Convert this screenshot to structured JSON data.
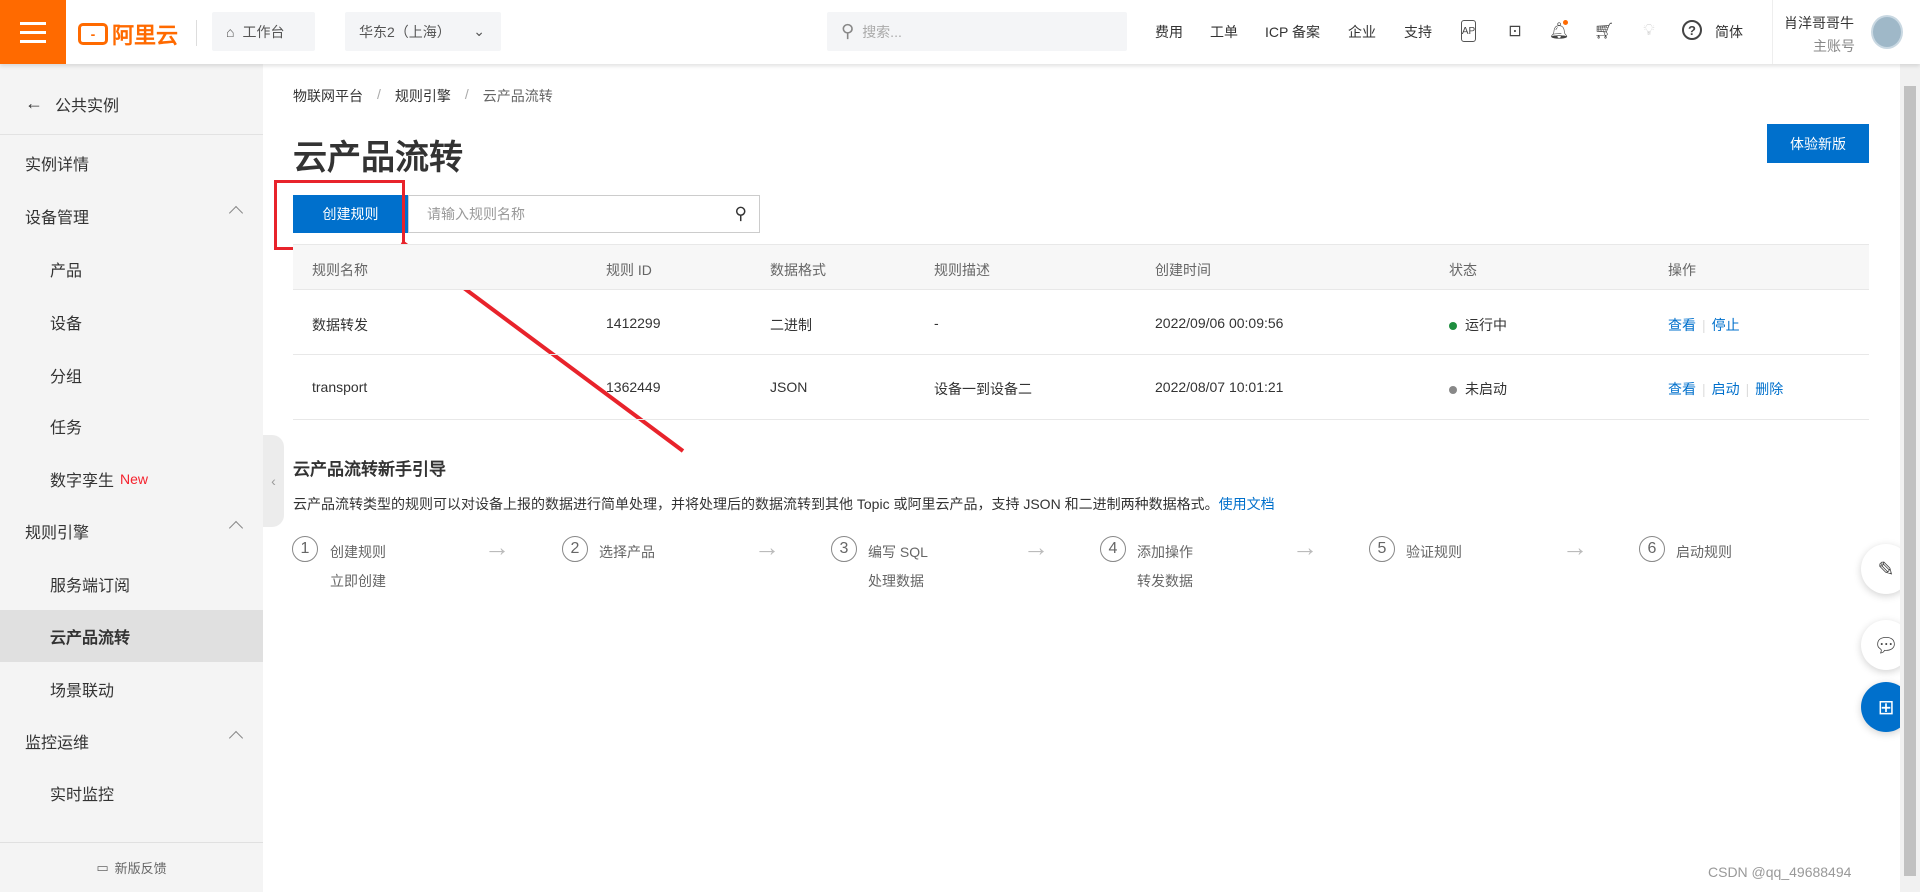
{
  "topbar": {
    "logo": "阿里云",
    "workbench": "工作台",
    "region": "华东2（上海）",
    "search_placeholder": "搜索...",
    "links": [
      "费用",
      "工单",
      "ICP 备案",
      "企业",
      "支持"
    ],
    "lang": "简体",
    "user_name": "肖洋哥哥牛",
    "user_role": "主账号"
  },
  "sidebar": {
    "back": "公共实例",
    "items": [
      {
        "label": "实例详情"
      },
      {
        "label": "设备管理"
      },
      {
        "label": "产品"
      },
      {
        "label": "设备"
      },
      {
        "label": "分组"
      },
      {
        "label": "任务"
      },
      {
        "label": "数字孪生",
        "badge": "New"
      },
      {
        "label": "规则引擎"
      },
      {
        "label": "服务端订阅"
      },
      {
        "label": "云产品流转"
      },
      {
        "label": "场景联动"
      },
      {
        "label": "监控运维"
      },
      {
        "label": "实时监控"
      }
    ],
    "feedback": "新版反馈"
  },
  "breadcrumb": [
    "物联网平台",
    "规则引擎",
    "云产品流转"
  ],
  "page": {
    "title": "云产品流转",
    "try_new": "体验新版",
    "create": "创建规则",
    "search_placeholder": "请输入规则名称"
  },
  "table": {
    "headers": [
      "规则名称",
      "规则 ID",
      "数据格式",
      "规则描述",
      "创建时间",
      "状态",
      "操作"
    ],
    "rows": [
      {
        "name": "数据转发",
        "id": "1412299",
        "format": "二进制",
        "desc": "-",
        "created": "2022/09/06 00:09:56",
        "status": "运行中",
        "status_color": "#1e8e3e",
        "actions": [
          "查看",
          "停止"
        ]
      },
      {
        "name": "transport",
        "id": "1362449",
        "format": "JSON",
        "desc": "设备一到设备二",
        "created": "2022/08/07 10:01:21",
        "status": "未启动",
        "status_color": "#888888",
        "actions": [
          "查看",
          "启动",
          "删除"
        ]
      }
    ]
  },
  "guide": {
    "title": "云产品流转新手引导",
    "desc": "云产品流转类型的规则可以对设备上报的数据进行简单处理，并将处理后的数据流转到其他 Topic 或阿里云产品，支持 JSON 和二进制两种数据格式。",
    "doc_link": "使用文档",
    "steps": [
      {
        "n": "1",
        "label": "创建规则",
        "sub": "立即创建"
      },
      {
        "n": "2",
        "label": "选择产品"
      },
      {
        "n": "3",
        "label": "编写 SQL",
        "sub": "处理数据"
      },
      {
        "n": "4",
        "label": "添加操作",
        "sub": "转发数据"
      },
      {
        "n": "5",
        "label": "验证规则"
      },
      {
        "n": "6",
        "label": "启动规则"
      }
    ]
  },
  "watermark": "CSDN @qq_49688494"
}
